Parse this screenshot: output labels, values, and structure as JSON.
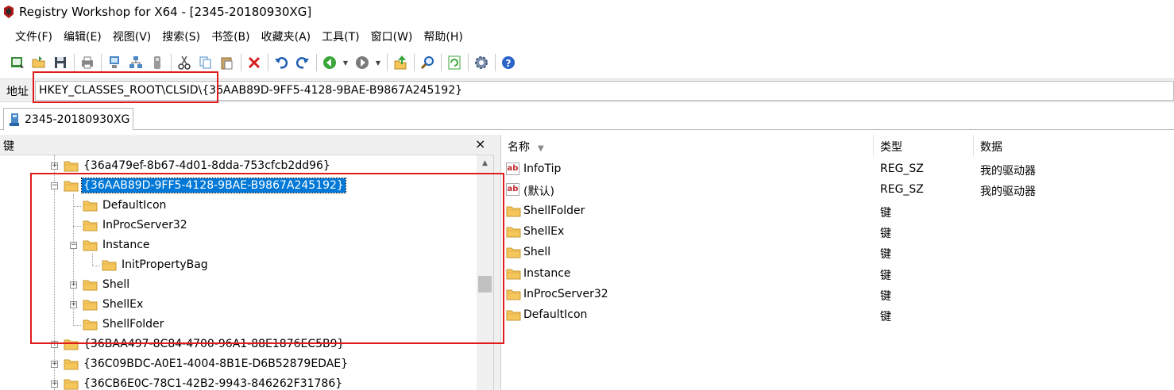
{
  "window": {
    "title": "Registry Workshop for X64 - [2345-20180930XG]",
    "app_icon": "registry-workshop-icon"
  },
  "menu": [
    "文件(F)",
    "编辑(E)",
    "视图(V)",
    "搜索(S)",
    "书签(B)",
    "收藏夹(A)",
    "工具(T)",
    "窗口(W)",
    "帮助(H)"
  ],
  "toolbar": {
    "buttons": [
      "connect-icon",
      "open-icon",
      "save-icon",
      "print-icon",
      "computer-icon",
      "network-icon",
      "device-icon",
      "cut-icon",
      "copy-icon",
      "paste-icon",
      "delete-icon",
      "undo-icon",
      "redo-icon",
      "back-icon",
      "forward-icon",
      "up-icon",
      "find-icon",
      "refresh-icon",
      "options-icon",
      "help-icon"
    ]
  },
  "address": {
    "label": "地址",
    "value": "HKEY_CLASSES_ROOT\\CLSID\\{36AAB89D-9FF5-4128-9BAE-B9867A245192}"
  },
  "tab": {
    "label": "2345-20180930XG"
  },
  "tree_pane": {
    "header": "键",
    "close": "×",
    "rows": [
      {
        "label": "{36a479ef-8b67-4d01-8dda-753cfcb2dd96}",
        "expander": "+"
      },
      {
        "label": "{36AAB89D-9FF5-4128-9BAE-B9867A245192}",
        "expander": "−",
        "selected": true
      },
      {
        "label": "DefaultIcon",
        "expander": ""
      },
      {
        "label": "InProcServer32",
        "expander": ""
      },
      {
        "label": "Instance",
        "expander": "−"
      },
      {
        "label": "InitPropertyBag",
        "expander": ""
      },
      {
        "label": "Shell",
        "expander": "+"
      },
      {
        "label": "ShellEx",
        "expander": "+"
      },
      {
        "label": "ShellFolder",
        "expander": ""
      },
      {
        "label": "{36BAA497-8C84-4700-96A1-88E1876EC5B9}",
        "expander": "+"
      },
      {
        "label": "{36C09BDC-A0E1-4004-8B1E-D6B52879EDAE}",
        "expander": "+"
      },
      {
        "label": "{36CB6E0C-78C1-42B2-9943-846262F31786}",
        "expander": "+"
      }
    ]
  },
  "list_pane": {
    "columns": [
      "名称",
      "类型",
      "数据"
    ],
    "rows": [
      {
        "icon": "string-value-icon",
        "name": "InfoTip",
        "type": "REG_SZ",
        "data": "我的驱动器"
      },
      {
        "icon": "string-value-icon",
        "name": "(默认)",
        "type": "REG_SZ",
        "data": "我的驱动器"
      },
      {
        "icon": "folder-icon",
        "name": "ShellFolder",
        "type": "键",
        "data": ""
      },
      {
        "icon": "folder-icon",
        "name": "ShellEx",
        "type": "键",
        "data": ""
      },
      {
        "icon": "folder-icon",
        "name": "Shell",
        "type": "键",
        "data": ""
      },
      {
        "icon": "folder-icon",
        "name": "Instance",
        "type": "键",
        "data": ""
      },
      {
        "icon": "folder-icon",
        "name": "InProcServer32",
        "type": "键",
        "data": ""
      },
      {
        "icon": "folder-icon",
        "name": "DefaultIcon",
        "type": "键",
        "data": ""
      }
    ]
  },
  "colors": {
    "highlight_box": "#e01b1b",
    "selection": "#0078d7",
    "folder": "#f5c65b"
  }
}
